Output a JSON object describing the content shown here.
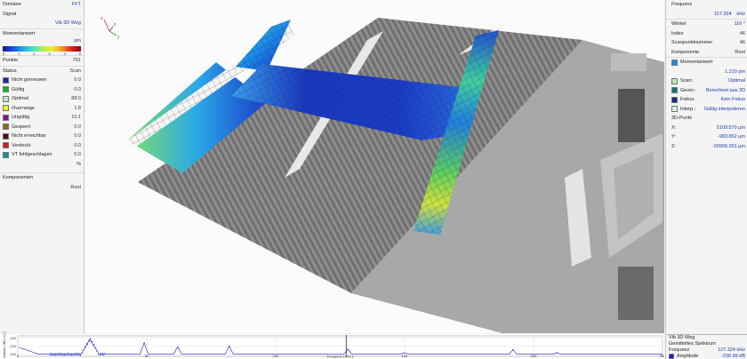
{
  "left_panel": {
    "domain_label": "Domäne",
    "domain_value": "FFT",
    "signal_label": "Signal",
    "signal_value": "Vib 3D Weg",
    "quantity_label": "Momentanwert",
    "unit": "pm",
    "scale_ticks": [
      "0",
      "1",
      "2",
      "3",
      "4",
      "5"
    ],
    "points_label": "Punkte",
    "points_value": "761",
    "status_label": "Status",
    "status_value": "Scan",
    "status_items": [
      {
        "label": "Nicht gemessen",
        "value": "0.0",
        "color": "#1a2aa0"
      },
      {
        "label": "Gültig",
        "value": "0.0",
        "color": "#18b030"
      },
      {
        "label": "Optimal",
        "value": "88.0",
        "color": "#b8e8b8"
      },
      {
        "label": "Overrange",
        "value": "1.8",
        "color": "#f0f020"
      },
      {
        "label": "Ungültig",
        "value": "10.1",
        "color": "#8a1090"
      },
      {
        "label": "Gesperrt",
        "value": "0.0",
        "color": "#8a6a18"
      },
      {
        "label": "Nicht erreichbar",
        "value": "0.0",
        "color": "#501010"
      },
      {
        "label": "Verdeckt",
        "value": "0.0",
        "color": "#d02020"
      },
      {
        "label": "VT fehlgeschlagen",
        "value": "0.0",
        "color": "#109090"
      }
    ],
    "percent": "%",
    "components_label": "Komponenten",
    "components_value": "Root"
  },
  "right_panel": {
    "freq_label": "Frequenz",
    "freq_value": "127.324",
    "freq_unit": "kHz",
    "angle_label": "Winkel",
    "angle_value": "116 °",
    "index_label": "Index",
    "index_value": "46",
    "scanpoint_label": "Scanpunktnummer",
    "scanpoint_value": "46",
    "component_label": "Komponente",
    "component_value": "Root",
    "momentary_label": "Momentanwert",
    "momentary_value": "1.210 pm",
    "scan_label": "Scan:",
    "scan_value": "Optimal",
    "geom_label": "Geom.:",
    "geom_value": "Berechnet aus 2D",
    "focus_label": "Fokus:",
    "focus_value": "Kein Fokus",
    "interp_label": "Interp.:",
    "interp_value": "Gültig interpolieren",
    "point3d_label": "3D-Punkt",
    "x_label": "X:",
    "x_value": "5109.570 µm",
    "y_label": "Y:",
    "y_value": "-983.862 µm",
    "z_label": "Z:",
    "z_value": "-20906.301 µm"
  },
  "spectrum_info": {
    "signal": "Vib 3D Weg",
    "type": "Gemitteltes Spektrum",
    "freq_label": "Frequenz",
    "freq_value": "127.324 kHz",
    "amp_label": "Amplitude",
    "amp_value": "-236.99 dB"
  },
  "chart_data": {
    "type": "line",
    "xlabel": "Frequenz [ kHz ]",
    "ylabel": "Amplitude [ dB(1 m) ]",
    "xlim": [
      0,
      250
    ],
    "ylim": [
      -245,
      -195
    ],
    "x_ticks": [
      0,
      50,
      100,
      150,
      200,
      250
    ],
    "y_ticks": [
      -200,
      -220,
      -240
    ],
    "cursor_x": 127.324,
    "series_color": "#1a1ac8",
    "peaks": [
      {
        "x": 28,
        "y": -203
      },
      {
        "x": 49,
        "y": -212
      },
      {
        "x": 62,
        "y": -222
      },
      {
        "x": 82,
        "y": -220
      },
      {
        "x": 128,
        "y": -228
      },
      {
        "x": 150,
        "y": -236
      },
      {
        "x": 192,
        "y": -229
      },
      {
        "x": 209,
        "y": -236
      }
    ],
    "floor": -240
  },
  "axis_gizmo": {
    "x": "x",
    "y": "y",
    "z": "z"
  }
}
